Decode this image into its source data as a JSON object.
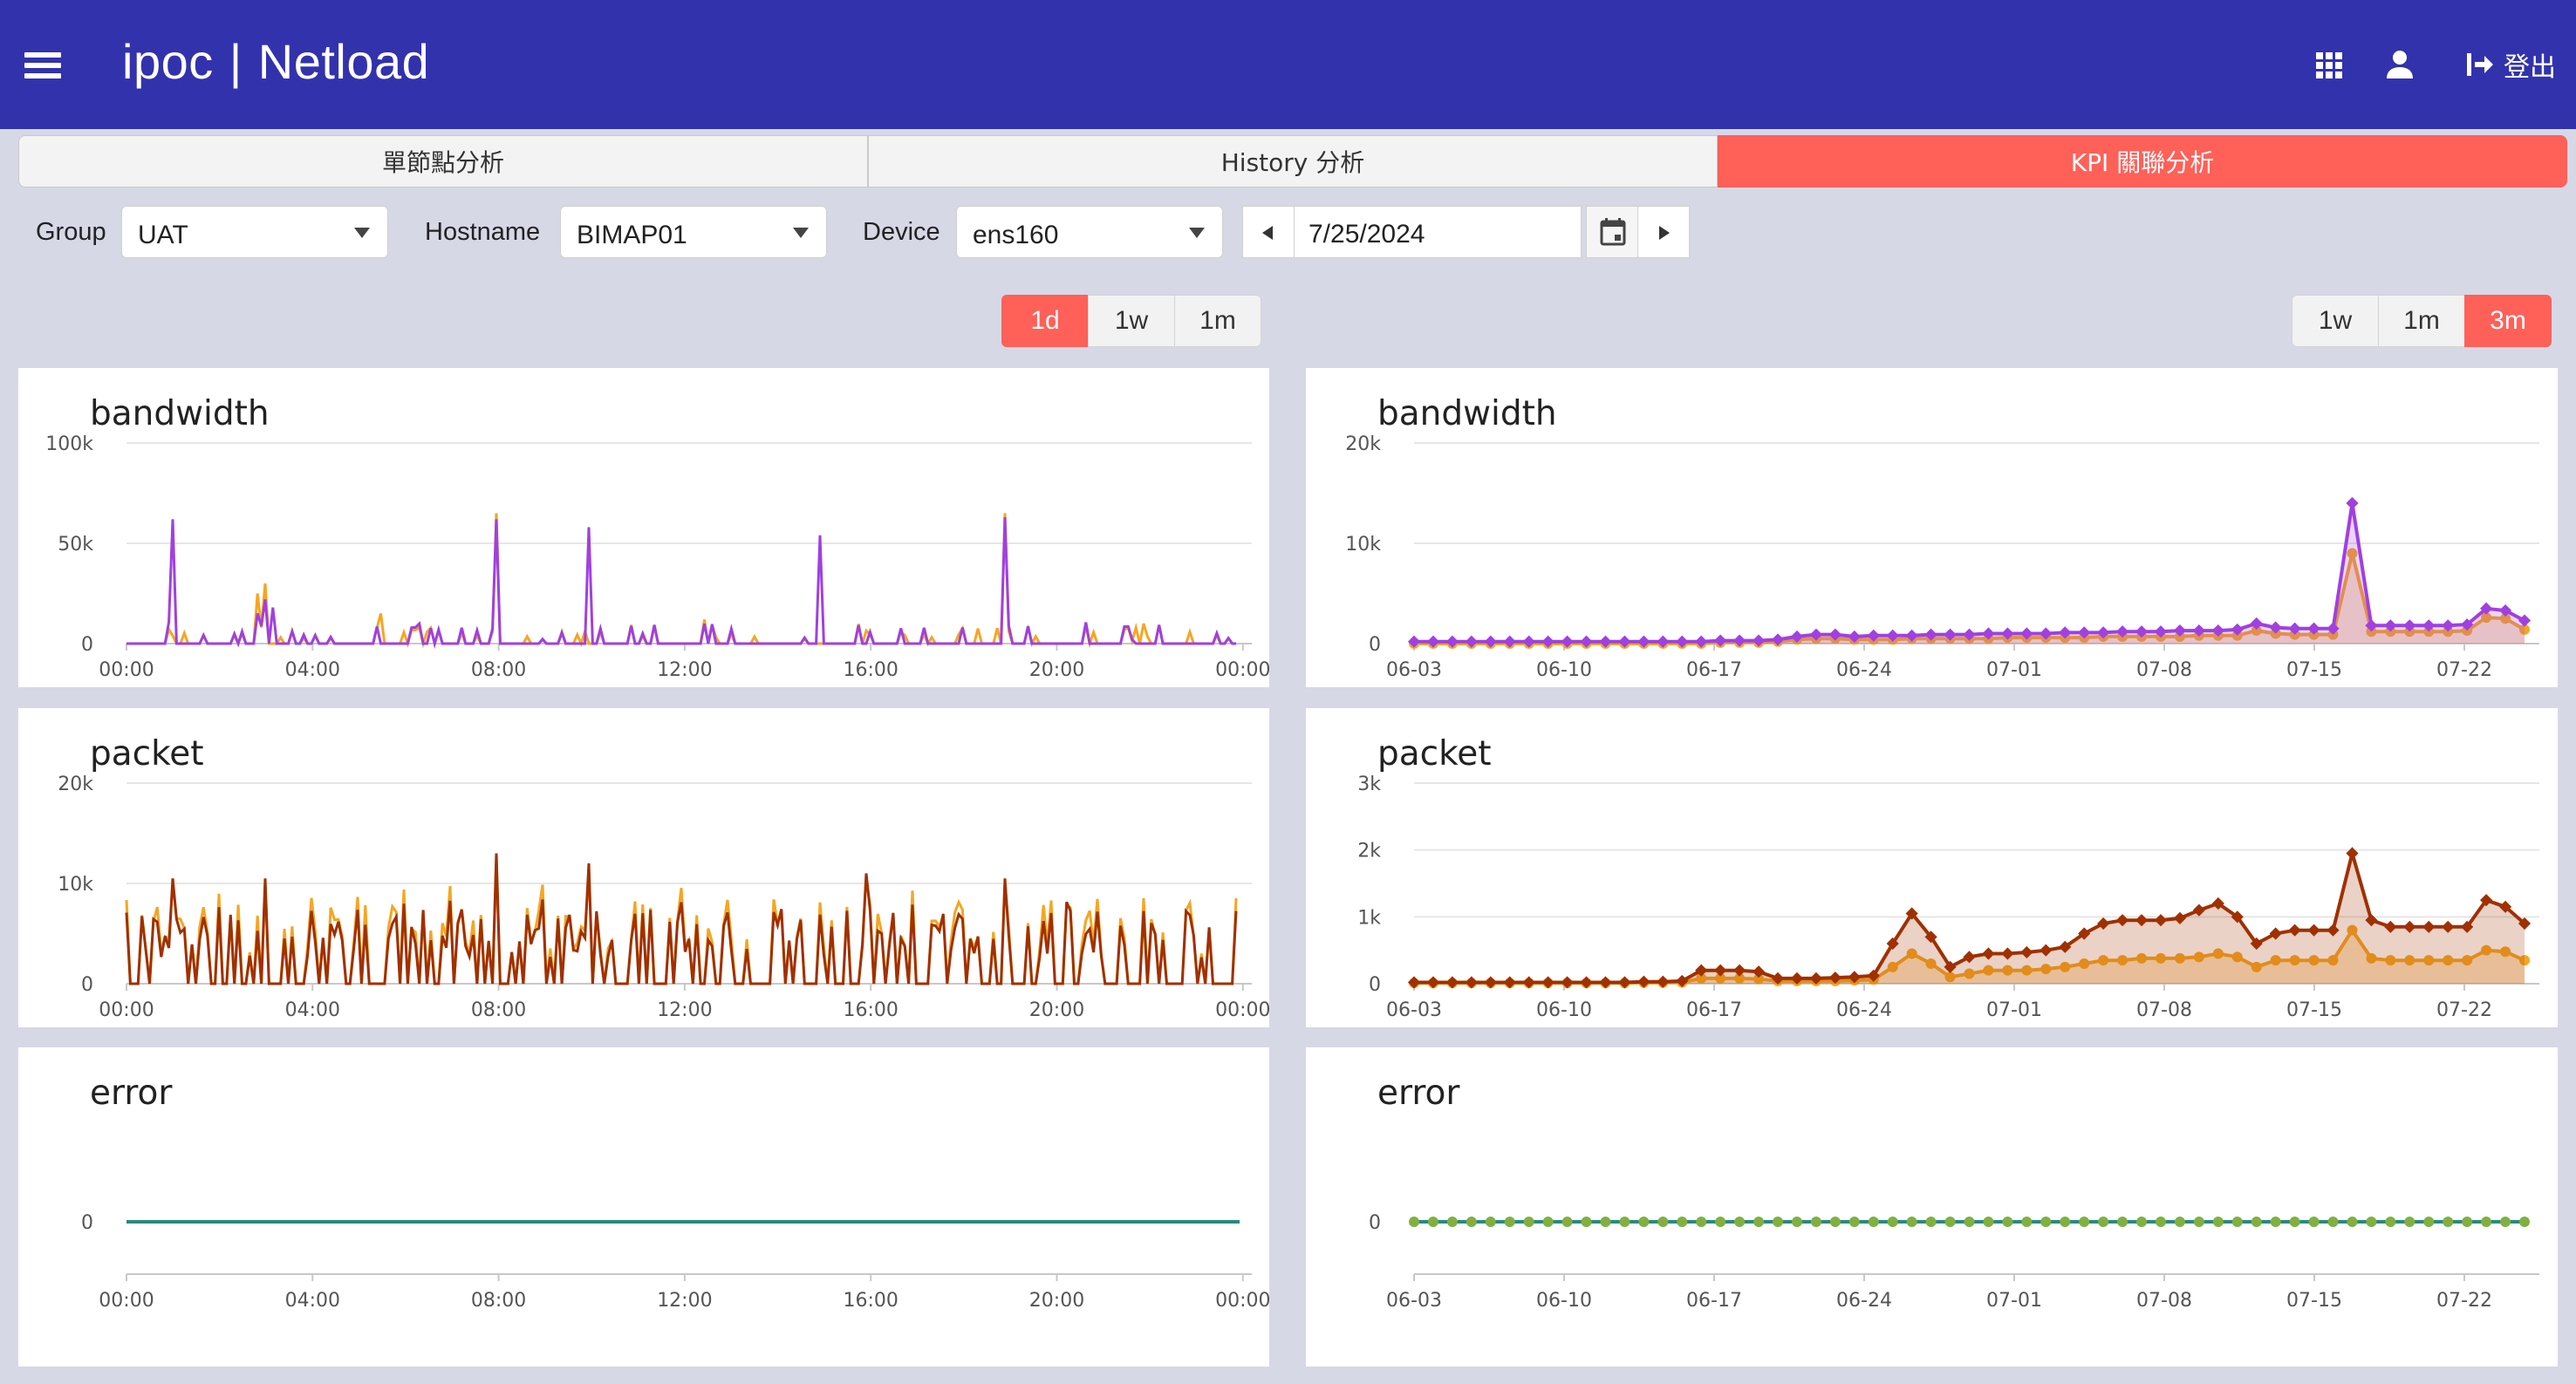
{
  "header": {
    "app_name": "ipoc",
    "separator": "|",
    "product_name": "Netload",
    "logout_label": "登出",
    "bar_color": "#3232ad"
  },
  "tabs": [
    {
      "label": "單節點分析",
      "active": false
    },
    {
      "label": "History 分析",
      "active": false
    },
    {
      "label": "KPI 關聯分析",
      "active": true
    }
  ],
  "filters": {
    "group_label": "Group",
    "group_value": "UAT",
    "hostname_label": "Hostname",
    "hostname_value": "BIMAP01",
    "device_label": "Device",
    "device_value": "ens160",
    "date_value": "7/25/2024"
  },
  "left_ranges": [
    {
      "label": "1d",
      "active": true
    },
    {
      "label": "1w",
      "active": false
    },
    {
      "label": "1m",
      "active": false
    }
  ],
  "right_ranges": [
    {
      "label": "1w",
      "active": false
    },
    {
      "label": "1m",
      "active": false
    },
    {
      "label": "3m",
      "active": true
    }
  ],
  "colors": {
    "accent": "#ff6058",
    "purple": "#a040e0",
    "orange": "#f5a623",
    "brown": "#a03000",
    "teal": "#2a8a80",
    "green": "#80b040"
  },
  "chart_data": [
    {
      "type": "line",
      "title": "bandwidth",
      "panel": "left",
      "x_ticks": [
        "00:00",
        "04:00",
        "08:00",
        "12:00",
        "16:00",
        "20:00",
        "00:00"
      ],
      "y_ticks": [
        "0",
        "50k",
        "100k"
      ],
      "ylim": [
        0,
        100000
      ],
      "series": [
        {
          "color": "#a040e0",
          "spikes": [
            [
              1.0,
              62000
            ],
            [
              3.0,
              22000
            ],
            [
              8.0,
              62000
            ],
            [
              10.0,
              58000
            ],
            [
              15.0,
              54000
            ],
            [
              19.0,
              63000
            ],
            [
              3.2,
              18000
            ],
            [
              2.8,
              15000
            ]
          ]
        },
        {
          "color": "#f5a623",
          "spikes": [
            [
              3.0,
              30000
            ],
            [
              2.8,
              25000
            ],
            [
              8.0,
              65000
            ],
            [
              19.0,
              65000
            ],
            [
              5.5,
              15000
            ],
            [
              12.5,
              12000
            ],
            [
              22.0,
              10000
            ]
          ]
        }
      ],
      "baseline_peak": 10000
    },
    {
      "type": "line",
      "title": "bandwidth",
      "panel": "right",
      "x_ticks": [
        "06-03",
        "06-10",
        "06-17",
        "06-24",
        "07-01",
        "07-08",
        "07-15",
        "07-22"
      ],
      "y_ticks": [
        "0",
        "10k",
        "20k"
      ],
      "ylim": [
        0,
        20000
      ],
      "series": [
        {
          "color": "#a040e0",
          "values": [
            200,
            200,
            200,
            200,
            200,
            200,
            200,
            200,
            200,
            200,
            200,
            200,
            200,
            200,
            200,
            200,
            300,
            300,
            300,
            400,
            700,
            900,
            900,
            700,
            800,
            800,
            800,
            900,
            900,
            900,
            1000,
            1000,
            1000,
            1000,
            1100,
            1100,
            1100,
            1200,
            1200,
            1200,
            1300,
            1300,
            1300,
            1400,
            2000,
            1600,
            1500,
            1500,
            1500,
            14000,
            1800,
            1800,
            1800,
            1800,
            1800,
            1900,
            3500,
            3300,
            2300
          ]
        },
        {
          "color": "#f5a623",
          "values": [
            0,
            0,
            0,
            0,
            0,
            0,
            0,
            0,
            0,
            0,
            0,
            0,
            0,
            0,
            0,
            0,
            100,
            100,
            100,
            200,
            400,
            500,
            500,
            400,
            400,
            400,
            500,
            500,
            500,
            500,
            500,
            600,
            600,
            600,
            600,
            600,
            700,
            700,
            700,
            700,
            700,
            800,
            800,
            800,
            1300,
            1000,
            900,
            900,
            900,
            9000,
            1200,
            1200,
            1200,
            1200,
            1200,
            1300,
            2600,
            2500,
            1400
          ]
        }
      ]
    },
    {
      "type": "line",
      "title": "packet",
      "panel": "left",
      "x_ticks": [
        "00:00",
        "04:00",
        "08:00",
        "12:00",
        "16:00",
        "20:00",
        "00:00"
      ],
      "y_ticks": [
        "0",
        "10k",
        "20k"
      ],
      "ylim": [
        0,
        20000
      ],
      "series": [
        {
          "color": "#f5a623",
          "peak": 13000
        },
        {
          "color": "#a03000",
          "peak": 12500
        }
      ],
      "baseline_peak": 10000
    },
    {
      "type": "area",
      "title": "packet",
      "panel": "right",
      "x_ticks": [
        "06-03",
        "06-10",
        "06-17",
        "06-24",
        "07-01",
        "07-08",
        "07-15",
        "07-22"
      ],
      "y_ticks": [
        "0",
        "1k",
        "2k",
        "3k"
      ],
      "ylim": [
        0,
        3000
      ],
      "series": [
        {
          "color": "#a03000",
          "values": [
            20,
            20,
            20,
            20,
            20,
            20,
            20,
            20,
            20,
            20,
            20,
            20,
            30,
            30,
            40,
            200,
            200,
            200,
            180,
            80,
            80,
            80,
            90,
            100,
            120,
            600,
            1050,
            700,
            250,
            400,
            450,
            450,
            470,
            500,
            550,
            750,
            900,
            950,
            950,
            950,
            980,
            1100,
            1200,
            1000,
            600,
            750,
            800,
            800,
            800,
            1950,
            950,
            850,
            850,
            850,
            850,
            850,
            1250,
            1150,
            900
          ]
        },
        {
          "color": "#f5a623",
          "values": [
            10,
            10,
            10,
            10,
            10,
            10,
            10,
            10,
            10,
            10,
            10,
            10,
            15,
            15,
            20,
            80,
            80,
            80,
            70,
            40,
            40,
            40,
            40,
            50,
            60,
            250,
            450,
            300,
            100,
            150,
            200,
            200,
            200,
            220,
            250,
            300,
            350,
            350,
            380,
            380,
            380,
            400,
            450,
            400,
            250,
            350,
            350,
            350,
            350,
            800,
            380,
            350,
            350,
            350,
            350,
            350,
            500,
            480,
            350
          ]
        }
      ]
    },
    {
      "type": "line",
      "title": "error",
      "panel": "left",
      "x_ticks": [
        "00:00",
        "04:00",
        "08:00",
        "12:00",
        "16:00",
        "20:00",
        "00:00"
      ],
      "y_ticks": [
        "0"
      ],
      "series": [
        {
          "color": "#2a8a80",
          "values": [
            0,
            0
          ]
        }
      ]
    },
    {
      "type": "line",
      "title": "error",
      "panel": "right",
      "x_ticks": [
        "06-03",
        "06-10",
        "06-17",
        "06-24",
        "07-01",
        "07-08",
        "07-15",
        "07-22"
      ],
      "y_ticks": [
        "0"
      ],
      "series": [
        {
          "color": "#80b040",
          "values": "all-zero"
        }
      ]
    }
  ]
}
